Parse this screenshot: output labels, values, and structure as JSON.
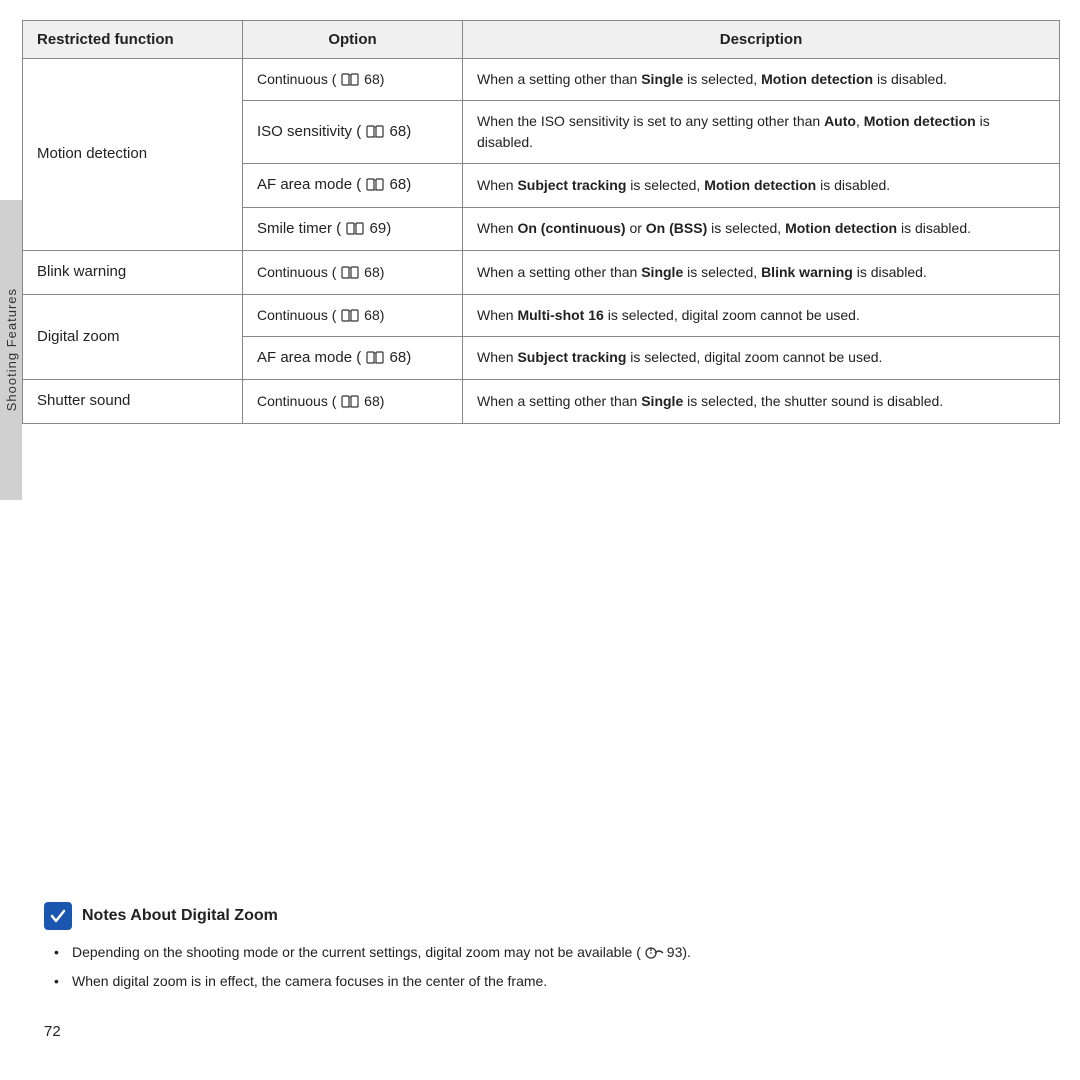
{
  "side_tab": {
    "label": "Shooting Features"
  },
  "table": {
    "headers": [
      "Restricted function",
      "Option",
      "Description"
    ],
    "rows": [
      {
        "restricted": "Motion detection",
        "rowspan": 4,
        "options": [
          {
            "option": "Continuous (□68)",
            "description_parts": [
              {
                "text": "When a setting other than ",
                "bold": false
              },
              {
                "text": "Single",
                "bold": true
              },
              {
                "text": " is selected, ",
                "bold": false
              },
              {
                "text": "Motion detection",
                "bold": true
              },
              {
                "text": " is disabled.",
                "bold": false
              }
            ]
          },
          {
            "option": "ISO sensitivity (□68)",
            "description_parts": [
              {
                "text": "When the ISO sensitivity is set to any setting other than ",
                "bold": false
              },
              {
                "text": "Auto",
                "bold": true
              },
              {
                "text": ", ",
                "bold": false
              },
              {
                "text": "Motion detection",
                "bold": true
              },
              {
                "text": " is disabled.",
                "bold": false
              }
            ]
          },
          {
            "option": "AF area mode (□68)",
            "description_parts": [
              {
                "text": "When ",
                "bold": false
              },
              {
                "text": "Subject tracking",
                "bold": true
              },
              {
                "text": " is selected, ",
                "bold": false
              },
              {
                "text": "Motion detection",
                "bold": true
              },
              {
                "text": " is disabled.",
                "bold": false
              }
            ]
          },
          {
            "option": "Smile timer (□69)",
            "description_parts": [
              {
                "text": "When ",
                "bold": false
              },
              {
                "text": "On (continuous)",
                "bold": true
              },
              {
                "text": " or ",
                "bold": false
              },
              {
                "text": "On (BSS)",
                "bold": true
              },
              {
                "text": " is selected, ",
                "bold": false
              },
              {
                "text": "Motion detection",
                "bold": true
              },
              {
                "text": " is disabled.",
                "bold": false
              }
            ]
          }
        ]
      },
      {
        "restricted": "Blink warning",
        "rowspan": 1,
        "options": [
          {
            "option": "Continuous (□68)",
            "description_parts": [
              {
                "text": "When a setting other than ",
                "bold": false
              },
              {
                "text": "Single",
                "bold": true
              },
              {
                "text": " is selected, ",
                "bold": false
              },
              {
                "text": "Blink warning",
                "bold": true
              },
              {
                "text": " is disabled.",
                "bold": false
              }
            ]
          }
        ]
      },
      {
        "restricted": "Digital zoom",
        "rowspan": 2,
        "options": [
          {
            "option": "Continuous (□68)",
            "description_parts": [
              {
                "text": "When ",
                "bold": false
              },
              {
                "text": "Multi-shot 16",
                "bold": true
              },
              {
                "text": " is selected, digital zoom cannot be used.",
                "bold": false
              }
            ]
          },
          {
            "option": "AF area mode (□68)",
            "description_parts": [
              {
                "text": "When ",
                "bold": false
              },
              {
                "text": "Subject tracking",
                "bold": true
              },
              {
                "text": " is selected, digital zoom cannot be used.",
                "bold": false
              }
            ]
          }
        ]
      },
      {
        "restricted": "Shutter sound",
        "rowspan": 1,
        "options": [
          {
            "option": "Continuous (□68)",
            "description_parts": [
              {
                "text": "When a setting other than ",
                "bold": false
              },
              {
                "text": "Single",
                "bold": true
              },
              {
                "text": " is selected, the shutter sound is disabled.",
                "bold": false
              }
            ]
          }
        ]
      }
    ]
  },
  "notes": {
    "title": "Notes About Digital Zoom",
    "items": [
      "Depending on the shooting mode or the current settings, digital zoom may not be available (🔒93).",
      "When digital zoom is in effect, the camera focuses in the center of the frame."
    ]
  },
  "page_number": "72"
}
